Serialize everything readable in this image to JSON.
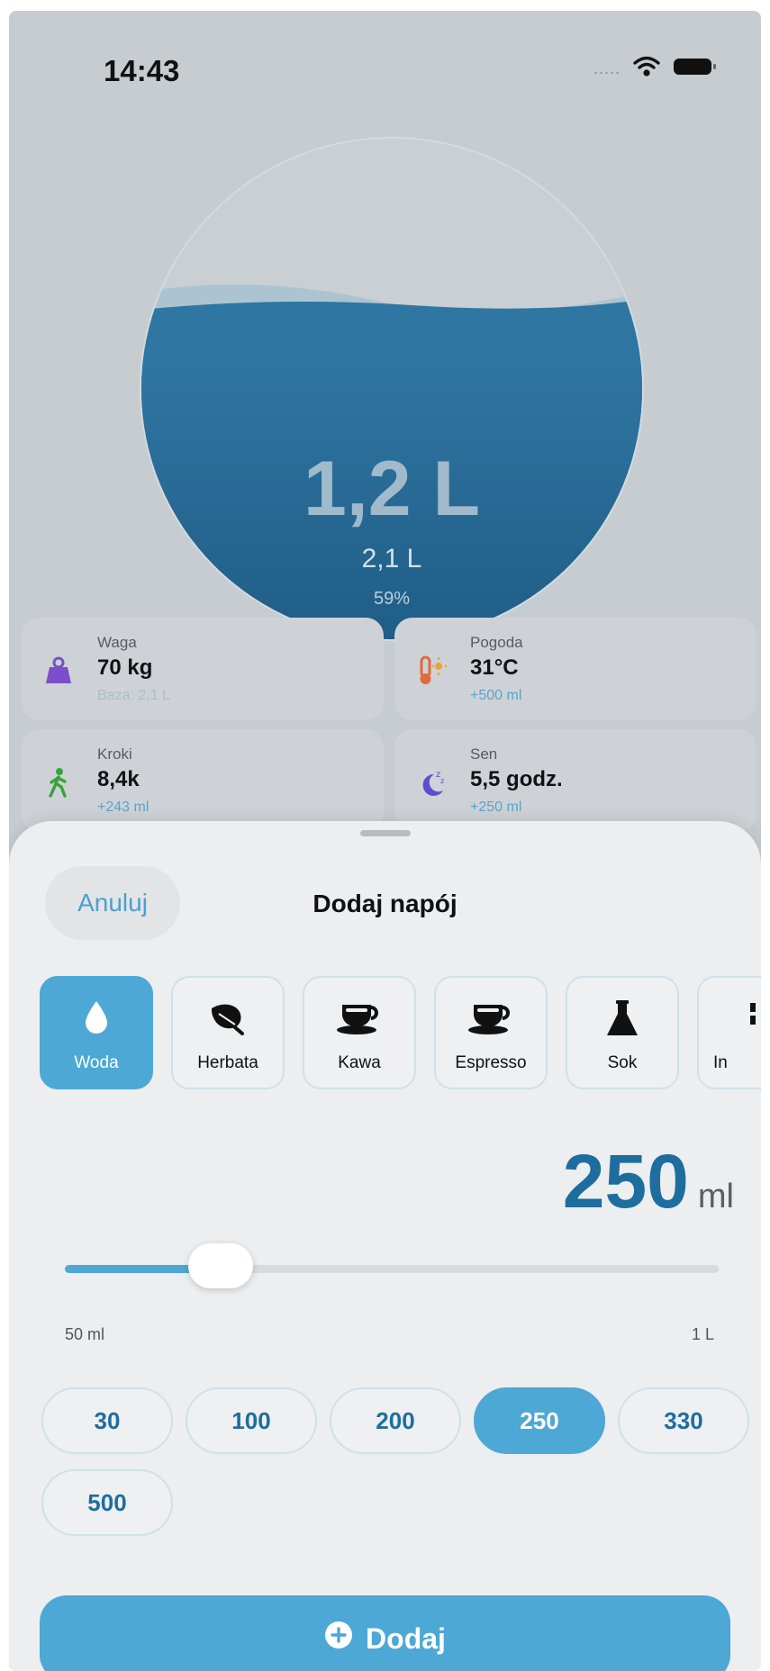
{
  "status_bar": {
    "time": "14:43",
    "signal": "....."
  },
  "gauge": {
    "current": "1,2 L",
    "goal": "2,1 L",
    "percent": "59%",
    "fill_fraction": 0.59
  },
  "stats": {
    "weight": {
      "label": "Waga",
      "value": "70 kg",
      "sub": "Baza: 2,1 L",
      "icon": "weight-icon"
    },
    "weather": {
      "label": "Pogoda",
      "value": "31°C",
      "sub": "+500 ml",
      "icon": "thermometer-sun-icon"
    },
    "steps": {
      "label": "Kroki",
      "value": "8,4k",
      "sub": "+243 ml",
      "icon": "walking-icon"
    },
    "sleep": {
      "label": "Sen",
      "value": "5,5 godz.",
      "sub": "+250 ml",
      "icon": "moon-sleep-icon"
    }
  },
  "sheet": {
    "cancel": "Anuluj",
    "title": "Dodaj napój",
    "drinks": [
      {
        "label": "Woda",
        "icon": "drop-icon",
        "selected": true
      },
      {
        "label": "Herbata",
        "icon": "leaf-icon",
        "selected": false
      },
      {
        "label": "Kawa",
        "icon": "cup-icon",
        "selected": false
      },
      {
        "label": "Espresso",
        "icon": "cup-icon",
        "selected": false
      },
      {
        "label": "Sok",
        "icon": "flask-icon",
        "selected": false
      },
      {
        "label": "In",
        "icon": "more-icon",
        "selected": false
      }
    ],
    "amount": {
      "value": "250",
      "unit": "ml"
    },
    "slider": {
      "min_label": "50 ml",
      "max_label": "1 L",
      "min": 50,
      "max": 1000,
      "value": 250
    },
    "presets": [
      "30",
      "100",
      "200",
      "250",
      "330",
      "500"
    ],
    "selected_preset": "250",
    "add_label": "Dodaj"
  },
  "colors": {
    "accent": "#4da8d5",
    "water": "#2a6e9a",
    "amount": "#1e6d9f"
  }
}
